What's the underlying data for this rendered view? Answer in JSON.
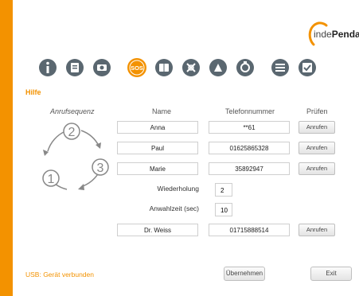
{
  "brand": {
    "logo_text_light": "inde",
    "logo_text_bold": "Pendan"
  },
  "toolbar": {
    "icons": [
      "info-icon",
      "book-icon",
      "camera-icon",
      "sos-icon",
      "contacts-icon",
      "map-icon",
      "fall-icon",
      "bracelet-icon",
      "settings-icon",
      "check-icon"
    ],
    "active": "sos-icon",
    "active_label": "SOS"
  },
  "section": {
    "title": "Hilfe"
  },
  "columns": {
    "sequence": "Anrufsequenz",
    "name": "Name",
    "phone": "Telefonnummer",
    "check": "Prüfen"
  },
  "sequence": {
    "steps": [
      "1",
      "2",
      "3"
    ]
  },
  "contacts": [
    {
      "name": "Anna",
      "phone": "**61",
      "button": "Anrufen"
    },
    {
      "name": "Paul",
      "phone": "01625865328",
      "button": "Anrufen"
    },
    {
      "name": "Marie",
      "phone": "35892947",
      "button": "Anrufen"
    }
  ],
  "repeat": {
    "label": "Wiederholung",
    "value": "2"
  },
  "dial_time": {
    "label": "Anwahlzeit (sec)",
    "value": "10"
  },
  "doctor": {
    "name": "Dr. Weiss",
    "phone": "01715888514",
    "button": "Anrufen"
  },
  "status": {
    "text": "USB: Gerät verbunden"
  },
  "actions": {
    "apply": "Übernehmen",
    "exit": "Exit"
  },
  "colors": {
    "accent": "#f39200",
    "icon": "#5a6770"
  }
}
